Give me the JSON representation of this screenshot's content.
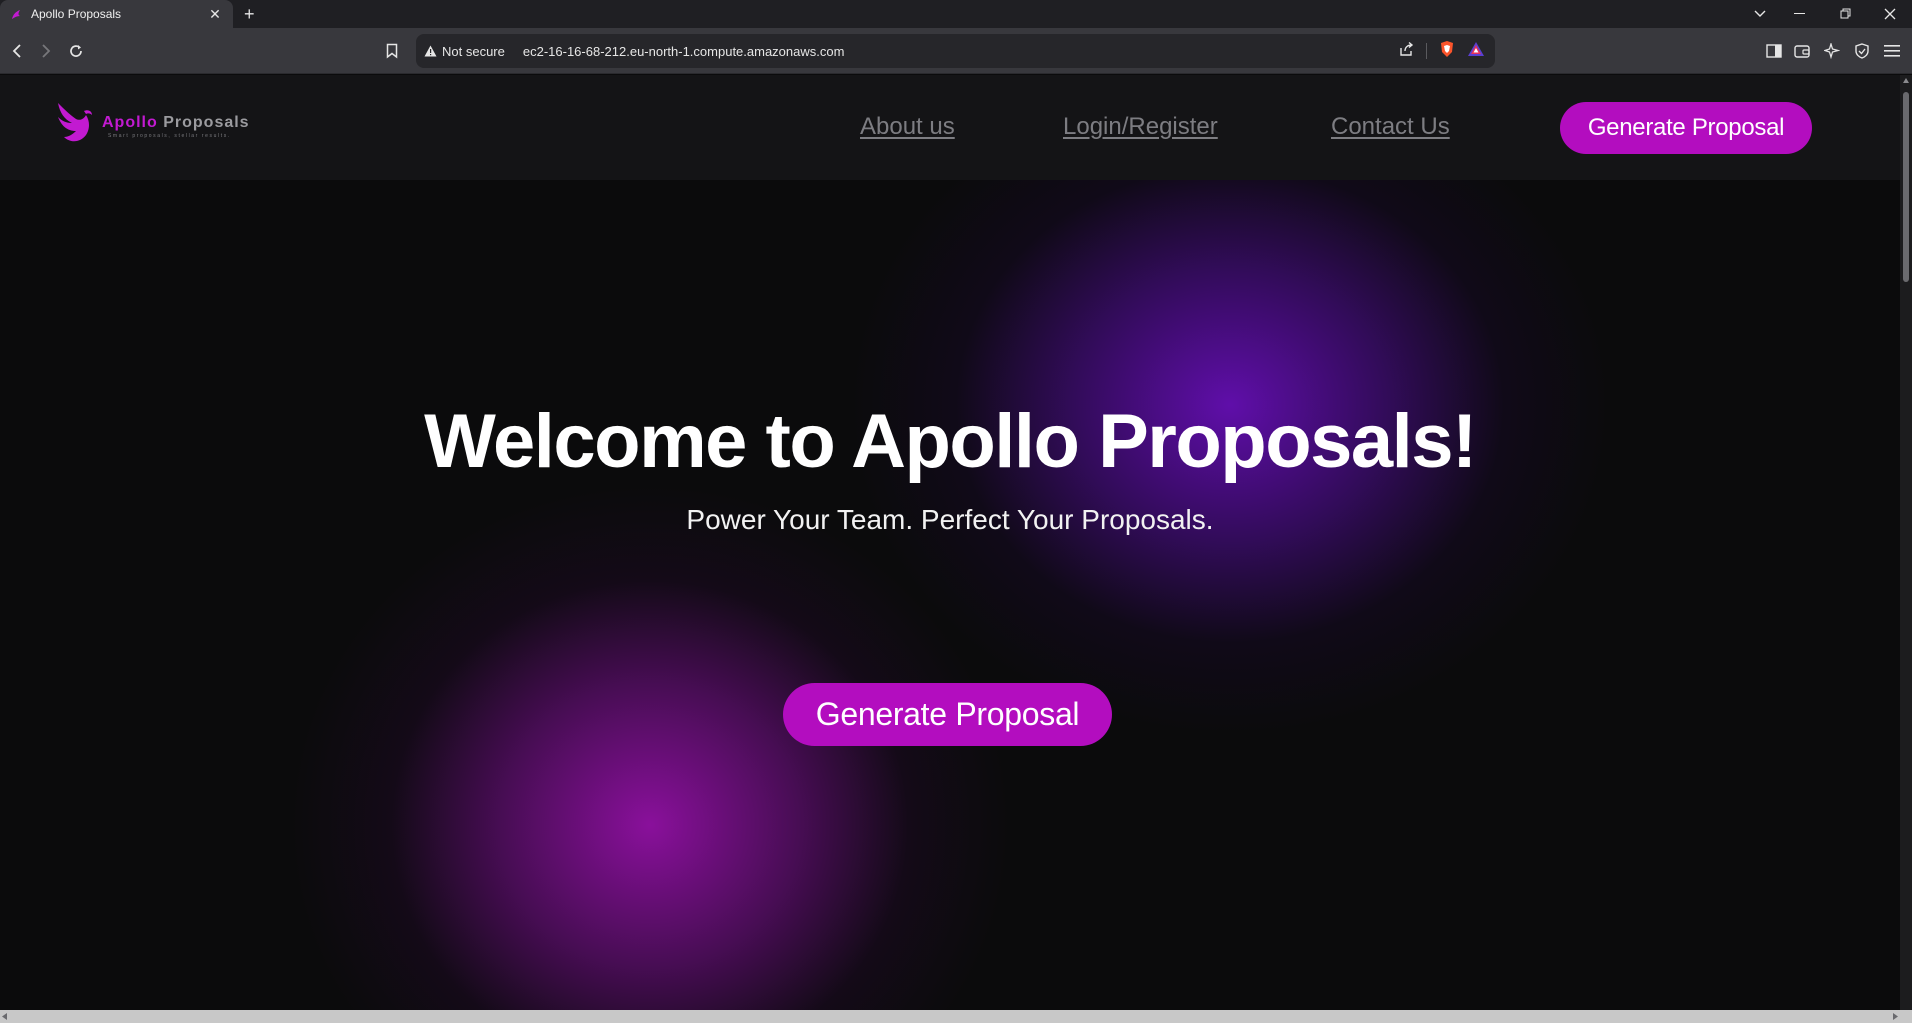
{
  "browser": {
    "tab_title": "Apollo Proposals",
    "new_tab": "+",
    "security_label": "Not secure",
    "url": "ec2-16-16-68-212.eu-north-1.compute.amazonaws.com"
  },
  "site": {
    "brand": {
      "name_part1": "Apollo",
      "name_part2": "Proposals",
      "tagline": "Smart proposals, stellar results."
    },
    "nav": [
      {
        "label": "About us"
      },
      {
        "label": "Login/Register"
      },
      {
        "label": "Contact Us"
      }
    ],
    "header_cta": "Generate Proposal"
  },
  "hero": {
    "title": "Welcome to Apollo Proposals!",
    "subtitle": "Power Your Team. Perfect Your Proposals.",
    "cta": "Generate Proposal"
  },
  "colors": {
    "accent": "#b30dbf",
    "logo_pink": "#c21ad1",
    "glow_purple": "#640eb2",
    "glow_magenta": "#8c109e",
    "background": "#0b0b0c"
  }
}
